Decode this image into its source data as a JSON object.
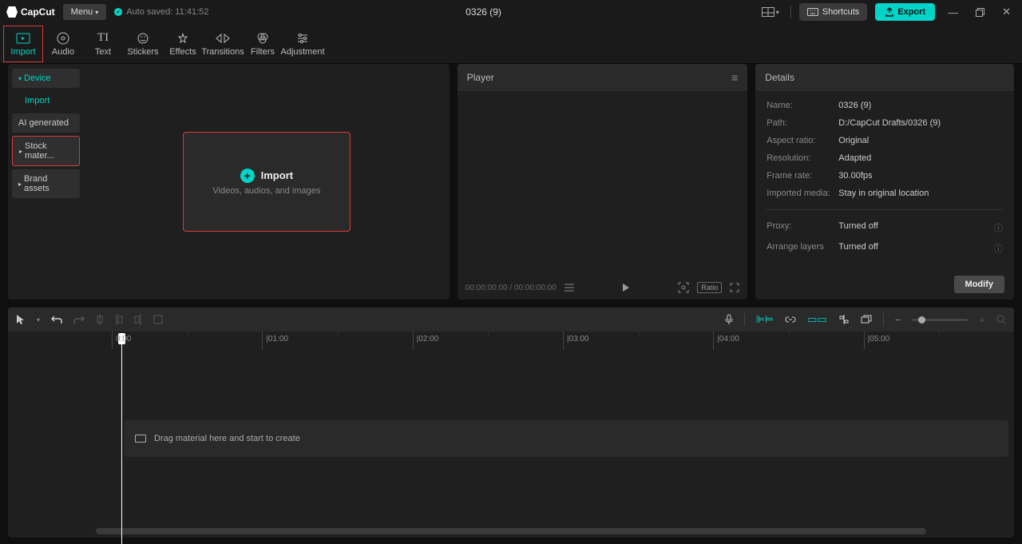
{
  "titlebar": {
    "app_name": "CapCut",
    "menu_label": "Menu",
    "autosave": "Auto saved: 11:41:52",
    "project_title": "0326 (9)",
    "shortcuts_label": "Shortcuts",
    "export_label": "Export"
  },
  "top_tabs": [
    {
      "label": "Import",
      "icon": "import"
    },
    {
      "label": "Audio",
      "icon": "audio"
    },
    {
      "label": "Text",
      "icon": "text"
    },
    {
      "label": "Stickers",
      "icon": "stickers"
    },
    {
      "label": "Effects",
      "icon": "effects"
    },
    {
      "label": "Transitions",
      "icon": "transitions"
    },
    {
      "label": "Filters",
      "icon": "filters"
    },
    {
      "label": "Adjustment",
      "icon": "adjustment"
    }
  ],
  "sidebar": {
    "items": [
      {
        "label": "Device",
        "expandable": true,
        "active": true
      },
      {
        "label": "Import",
        "sub": true,
        "active": true
      },
      {
        "label": "AI generated",
        "sub": false
      },
      {
        "label": "Stock mater...",
        "expandable": true,
        "highlighted": true
      },
      {
        "label": "Brand assets",
        "expandable": true
      }
    ]
  },
  "import_box": {
    "title": "Import",
    "subtitle": "Videos, audios, and images"
  },
  "player": {
    "title": "Player",
    "time": "00:00:00:00 / 00:00:00:00",
    "ratio_label": "Ratio"
  },
  "details": {
    "title": "Details",
    "rows": {
      "name_label": "Name:",
      "name_value": "0326 (9)",
      "path_label": "Path:",
      "path_value": "D:/CapCut Drafts/0326 (9)",
      "aspect_label": "Aspect ratio:",
      "aspect_value": "Original",
      "resolution_label": "Resolution:",
      "resolution_value": "Adapted",
      "framerate_label": "Frame rate:",
      "framerate_value": "30.00fps",
      "imported_label": "Imported media:",
      "imported_value": "Stay in original location",
      "proxy_label": "Proxy:",
      "proxy_value": "Turned off",
      "arrange_label": "Arrange layers",
      "arrange_value": "Turned off"
    },
    "modify_label": "Modify"
  },
  "timeline": {
    "ruler": [
      "0:00",
      "|01:00",
      "|02:00",
      "|03:00",
      "|04:00",
      "|05:00"
    ],
    "drag_hint": "Drag material here and start to create"
  }
}
